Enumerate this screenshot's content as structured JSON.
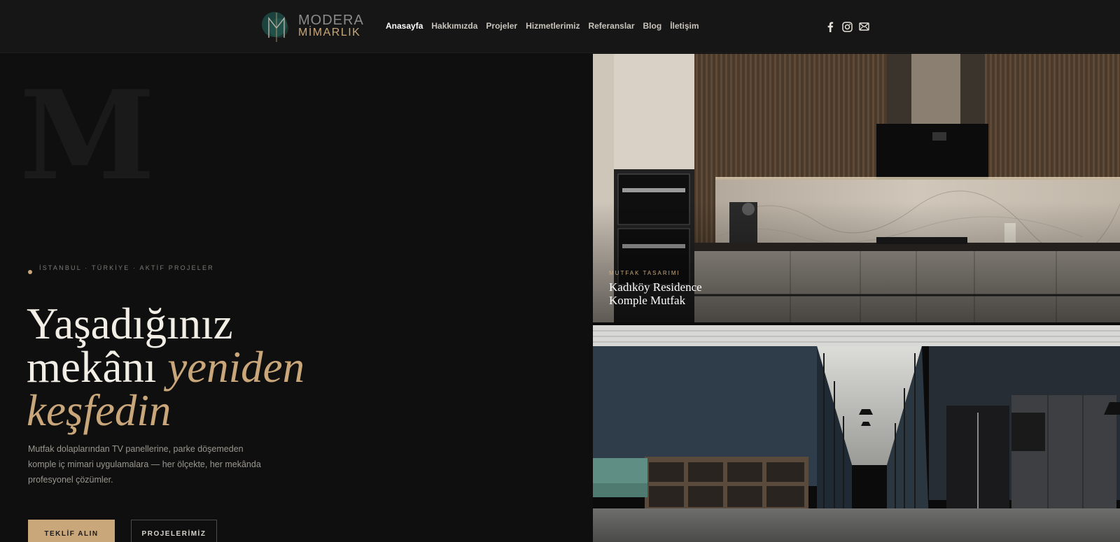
{
  "brand": {
    "name_line1": "MODERA",
    "name_line2": "MİMARLIK",
    "accent_color": "#c9a77a"
  },
  "nav": {
    "items": [
      {
        "label": "Anasayfa",
        "active": true
      },
      {
        "label": "Hakkımızda",
        "active": false
      },
      {
        "label": "Projeler",
        "active": false
      },
      {
        "label": "Hizmetlerimiz",
        "active": false
      },
      {
        "label": "Referanslar",
        "active": false
      },
      {
        "label": "Blog",
        "active": false
      },
      {
        "label": "İletişim",
        "active": false
      }
    ]
  },
  "social": {
    "icons": [
      "facebook-icon",
      "instagram-icon",
      "mail-icon"
    ]
  },
  "hero": {
    "bg_letter": "M",
    "location": "İSTANBUL · TÜRKİYE · AKTİF PROJELER",
    "headline_line1": "Yaşadığınız",
    "headline_line2_plain": "mekânı ",
    "headline_line2_gold": "yeniden",
    "headline_line3_gold": "keşfedin",
    "description": "Mutfak dolaplarından TV panellerine, parke döşemeden komple iç mimari uygulamalara — her ölçekte, her mekânda profesyonel çözümler.",
    "primary_button": "TEKLİF ALIN",
    "secondary_button": "PROJELERİMİZ"
  },
  "projects": [
    {
      "category": "MUTFAK TASARIMI",
      "title_line1": "Kadıköy Residence",
      "title_line2": "Komple Mutfak",
      "image": "kitchen-photo"
    },
    {
      "image": "office-photo"
    }
  ]
}
